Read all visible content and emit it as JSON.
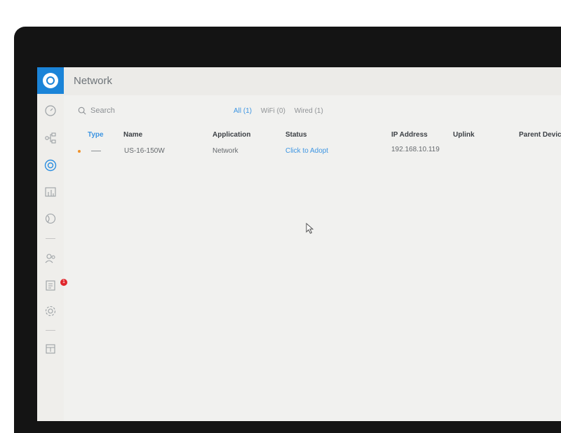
{
  "header": {
    "title": "Network"
  },
  "search": {
    "placeholder": "Search"
  },
  "filters": [
    {
      "label": "All (1)",
      "active": true
    },
    {
      "label": "WiFi (0)",
      "active": false
    },
    {
      "label": "Wired (1)",
      "active": false
    }
  ],
  "table": {
    "columns": [
      "Type",
      "Name",
      "Application",
      "Status",
      "IP Address",
      "Uplink",
      "Parent Devic"
    ],
    "rows": [
      {
        "type_indicator": "orange-dot",
        "name": "US-16-150W",
        "application": "Network",
        "status": "Click to Adopt",
        "ip": "192.168.10.119",
        "uplink": "",
        "parent": ""
      }
    ]
  },
  "sidebar": {
    "items": [
      "dashboard-icon",
      "topology-icon",
      "devices-icon",
      "statistics-icon",
      "insights-icon",
      "clients-icon",
      "alerts-icon",
      "settings-icon",
      "events-icon"
    ],
    "active": "devices-icon",
    "badge": "1"
  },
  "colors": {
    "accent": "#1b84d8",
    "link": "#3d95e2",
    "badge": "#e0262c",
    "status_dot": "#f0922b"
  }
}
